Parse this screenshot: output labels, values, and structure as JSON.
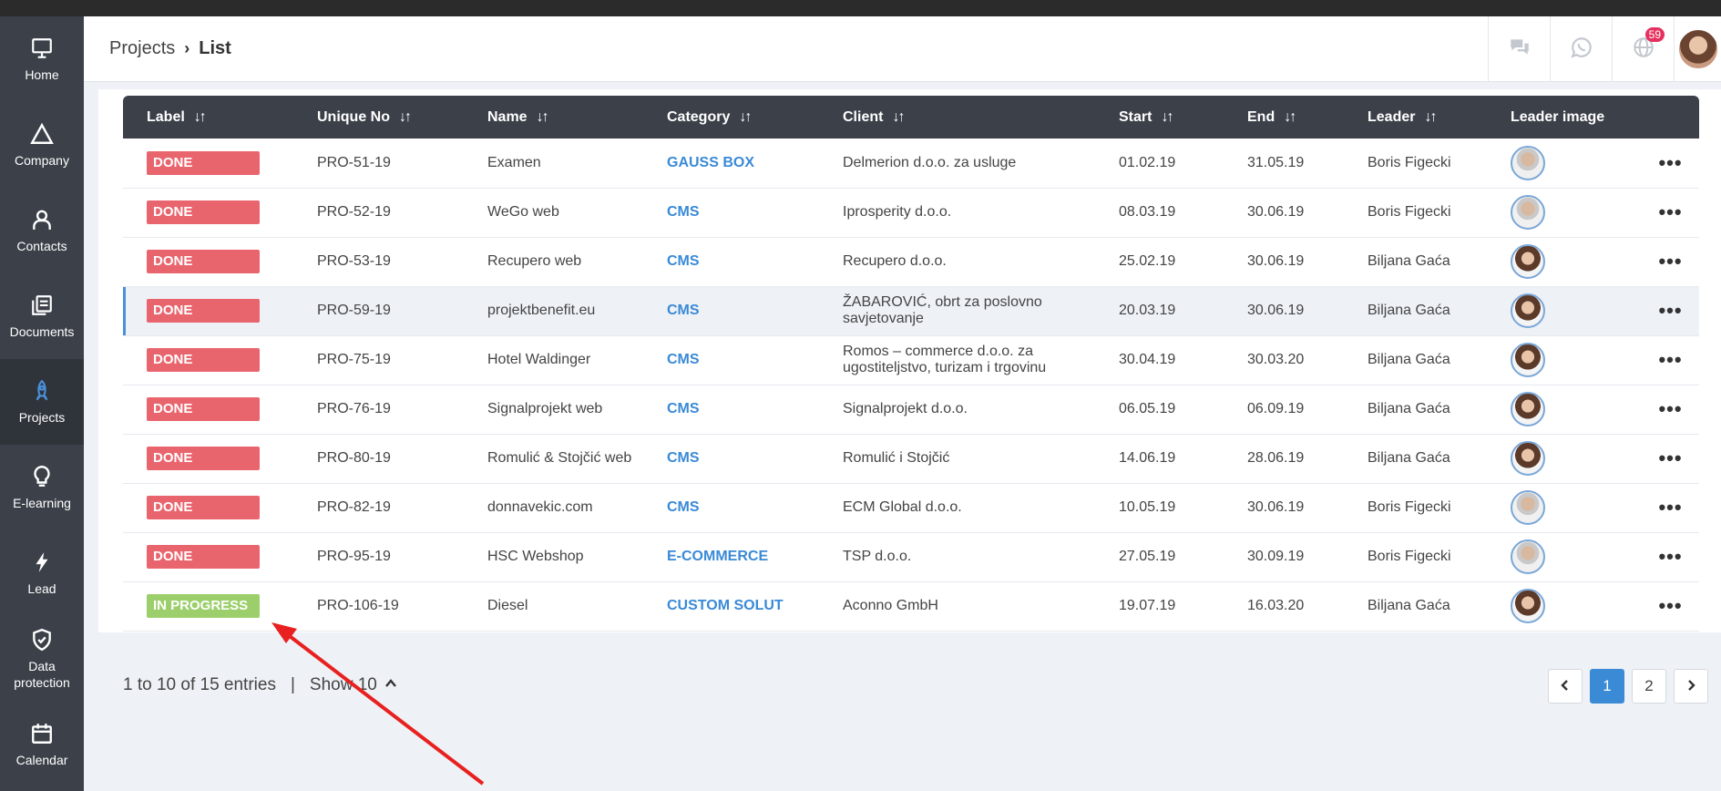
{
  "sidebar": {
    "items": [
      {
        "label": "Home",
        "icon": "monitor-icon"
      },
      {
        "label": "Company",
        "icon": "triangle-icon"
      },
      {
        "label": "Contacts",
        "icon": "person-icon"
      },
      {
        "label": "Documents",
        "icon": "documents-icon"
      },
      {
        "label": "Projects",
        "icon": "rocket-icon"
      },
      {
        "label": "E-learning",
        "icon": "lightbulb-icon"
      },
      {
        "label": "Lead",
        "icon": "lightning-icon"
      },
      {
        "label": "Data protection",
        "icon": "shield-icon"
      },
      {
        "label": "Calendar",
        "icon": "calendar-icon"
      }
    ],
    "active": "Projects"
  },
  "header": {
    "breadcrumb_root": "Projects",
    "breadcrumb_sep": "›",
    "breadcrumb_current": "List",
    "notification_badge": "59",
    "icons": [
      "chat-icon",
      "whatsapp-icon",
      "globe-icon",
      "avatar"
    ]
  },
  "table": {
    "columns": {
      "label": "Label",
      "unique_no": "Unique No",
      "name": "Name",
      "category": "Category",
      "client": "Client",
      "start": "Start",
      "end": "End",
      "leader": "Leader",
      "leader_image": "Leader image"
    },
    "sort_glyph": "↓↑",
    "more_glyph": "•••",
    "rows": [
      {
        "label": "DONE",
        "unique_no": "PRO-51-19",
        "name": "Examen",
        "category": "GAUSS BOX",
        "client": "Delmerion d.o.o. za usluge",
        "start": "01.02.19",
        "end": "31.05.19",
        "leader": "Boris Figecki",
        "leader_image": "m"
      },
      {
        "label": "DONE",
        "unique_no": "PRO-52-19",
        "name": "WeGo web",
        "category": "CMS",
        "client": "Iprosperity d.o.o.",
        "start": "08.03.19",
        "end": "30.06.19",
        "leader": "Boris Figecki",
        "leader_image": "m"
      },
      {
        "label": "DONE",
        "unique_no": "PRO-53-19",
        "name": "Recupero web",
        "category": "CMS",
        "client": "Recupero d.o.o.",
        "start": "25.02.19",
        "end": "30.06.19",
        "leader": "Biljana Gaća",
        "leader_image": "f"
      },
      {
        "label": "DONE",
        "unique_no": "PRO-59-19",
        "name": "projektbenefit.eu",
        "category": "CMS",
        "client": "ŽABAROVIĆ, obrt za poslovno savjetovanje",
        "start": "20.03.19",
        "end": "30.06.19",
        "leader": "Biljana Gaća",
        "leader_image": "f"
      },
      {
        "label": "DONE",
        "unique_no": "PRO-75-19",
        "name": "Hotel Waldinger",
        "category": "CMS",
        "client": "Romos – commerce d.o.o. za ugostiteljstvo, turizam i trgovinu",
        "start": "30.04.19",
        "end": "30.03.20",
        "leader": "Biljana Gaća",
        "leader_image": "f"
      },
      {
        "label": "DONE",
        "unique_no": "PRO-76-19",
        "name": "Signalprojekt web",
        "category": "CMS",
        "client": "Signalprojekt d.o.o.",
        "start": "06.05.19",
        "end": "06.09.19",
        "leader": "Biljana Gaća",
        "leader_image": "f"
      },
      {
        "label": "DONE",
        "unique_no": "PRO-80-19",
        "name": "Romulić & Stojčić web",
        "category": "CMS",
        "client": "Romulić i Stojčić",
        "start": "14.06.19",
        "end": "28.06.19",
        "leader": "Biljana Gaća",
        "leader_image": "f"
      },
      {
        "label": "DONE",
        "unique_no": "PRO-82-19",
        "name": "donnavekic.com",
        "category": "CMS",
        "client": "ECM Global d.o.o.",
        "start": "10.05.19",
        "end": "30.06.19",
        "leader": "Boris Figecki",
        "leader_image": "m"
      },
      {
        "label": "DONE",
        "unique_no": "PRO-95-19",
        "name": "HSC Webshop",
        "category": "E-COMMERCE",
        "client": "TSP d.o.o.",
        "start": "27.05.19",
        "end": "30.09.19",
        "leader": "Boris Figecki",
        "leader_image": "m"
      },
      {
        "label": "IN PROGRESS",
        "unique_no": "PRO-106-19",
        "name": "Diesel",
        "category": "CUSTOM SOLUT",
        "client": "Aconno GmbH",
        "start": "19.07.19",
        "end": "16.03.20",
        "leader": "Biljana Gaća",
        "leader_image": "f"
      }
    ],
    "highlighted_row": 3
  },
  "footer": {
    "entries_text": "1 to 10 of 15 entries",
    "divider": "|",
    "show_text": "Show 10",
    "pages": [
      "1",
      "2"
    ],
    "active_page": "1"
  },
  "colors": {
    "sidebar_bg": "#3b4049",
    "done": "#e9656e",
    "in_progress": "#9ccf6b",
    "accent": "#3a8ad6",
    "annotation_arrow": "#e8201f"
  }
}
